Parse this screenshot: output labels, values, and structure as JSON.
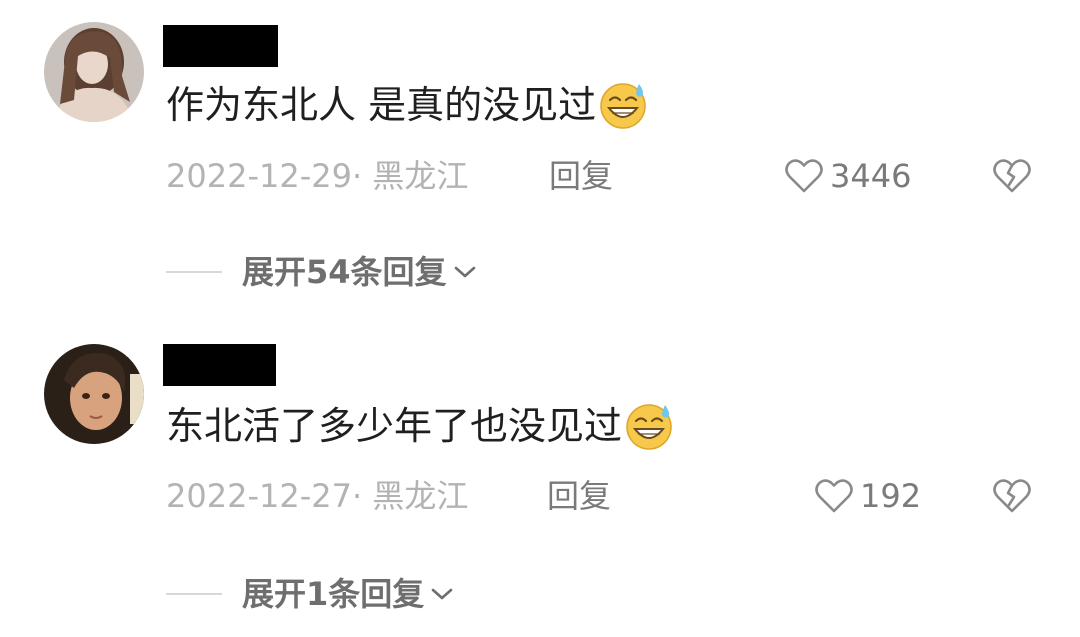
{
  "comments": [
    {
      "text": "作为东北人 是真的没见过",
      "emoji": "grinning-sweat-emoji",
      "date": "2022-12-29",
      "sep": "·",
      "location": "黑龙江",
      "reply_label": "回复",
      "likes": "3446",
      "expand_label": "展开54条回复"
    },
    {
      "text": "东北活了多少年了也没见过",
      "emoji": "grinning-sweat-emoji",
      "date": "2022-12-27",
      "sep": "·",
      "location": "黑龙江",
      "reply_label": "回复",
      "likes": "192",
      "expand_label": "展开1条回复"
    }
  ],
  "icons": {
    "like": "heart-outline-icon",
    "dislike": "broken-heart-icon",
    "expand": "chevron-down-icon"
  },
  "colors": {
    "text_primary": "#1f1f1f",
    "text_meta": "#b3b3b3",
    "text_secondary": "#7a7a7a",
    "redaction": "#000000"
  }
}
